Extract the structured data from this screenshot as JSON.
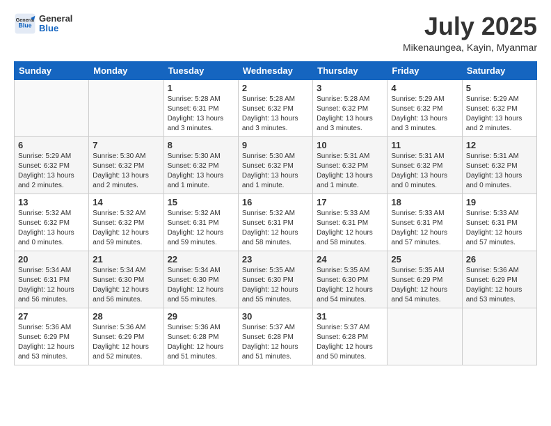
{
  "logo": {
    "general": "General",
    "blue": "Blue"
  },
  "title": "July 2025",
  "subtitle": "Mikenaungea, Kayin, Myanmar",
  "header_days": [
    "Sunday",
    "Monday",
    "Tuesday",
    "Wednesday",
    "Thursday",
    "Friday",
    "Saturday"
  ],
  "weeks": [
    [
      {
        "day": "",
        "info": ""
      },
      {
        "day": "",
        "info": ""
      },
      {
        "day": "1",
        "info": "Sunrise: 5:28 AM\nSunset: 6:31 PM\nDaylight: 13 hours\nand 3 minutes."
      },
      {
        "day": "2",
        "info": "Sunrise: 5:28 AM\nSunset: 6:32 PM\nDaylight: 13 hours\nand 3 minutes."
      },
      {
        "day": "3",
        "info": "Sunrise: 5:28 AM\nSunset: 6:32 PM\nDaylight: 13 hours\nand 3 minutes."
      },
      {
        "day": "4",
        "info": "Sunrise: 5:29 AM\nSunset: 6:32 PM\nDaylight: 13 hours\nand 3 minutes."
      },
      {
        "day": "5",
        "info": "Sunrise: 5:29 AM\nSunset: 6:32 PM\nDaylight: 13 hours\nand 2 minutes."
      }
    ],
    [
      {
        "day": "6",
        "info": "Sunrise: 5:29 AM\nSunset: 6:32 PM\nDaylight: 13 hours\nand 2 minutes."
      },
      {
        "day": "7",
        "info": "Sunrise: 5:30 AM\nSunset: 6:32 PM\nDaylight: 13 hours\nand 2 minutes."
      },
      {
        "day": "8",
        "info": "Sunrise: 5:30 AM\nSunset: 6:32 PM\nDaylight: 13 hours\nand 1 minute."
      },
      {
        "day": "9",
        "info": "Sunrise: 5:30 AM\nSunset: 6:32 PM\nDaylight: 13 hours\nand 1 minute."
      },
      {
        "day": "10",
        "info": "Sunrise: 5:31 AM\nSunset: 6:32 PM\nDaylight: 13 hours\nand 1 minute."
      },
      {
        "day": "11",
        "info": "Sunrise: 5:31 AM\nSunset: 6:32 PM\nDaylight: 13 hours\nand 0 minutes."
      },
      {
        "day": "12",
        "info": "Sunrise: 5:31 AM\nSunset: 6:32 PM\nDaylight: 13 hours\nand 0 minutes."
      }
    ],
    [
      {
        "day": "13",
        "info": "Sunrise: 5:32 AM\nSunset: 6:32 PM\nDaylight: 13 hours\nand 0 minutes."
      },
      {
        "day": "14",
        "info": "Sunrise: 5:32 AM\nSunset: 6:32 PM\nDaylight: 12 hours\nand 59 minutes."
      },
      {
        "day": "15",
        "info": "Sunrise: 5:32 AM\nSunset: 6:31 PM\nDaylight: 12 hours\nand 59 minutes."
      },
      {
        "day": "16",
        "info": "Sunrise: 5:32 AM\nSunset: 6:31 PM\nDaylight: 12 hours\nand 58 minutes."
      },
      {
        "day": "17",
        "info": "Sunrise: 5:33 AM\nSunset: 6:31 PM\nDaylight: 12 hours\nand 58 minutes."
      },
      {
        "day": "18",
        "info": "Sunrise: 5:33 AM\nSunset: 6:31 PM\nDaylight: 12 hours\nand 57 minutes."
      },
      {
        "day": "19",
        "info": "Sunrise: 5:33 AM\nSunset: 6:31 PM\nDaylight: 12 hours\nand 57 minutes."
      }
    ],
    [
      {
        "day": "20",
        "info": "Sunrise: 5:34 AM\nSunset: 6:31 PM\nDaylight: 12 hours\nand 56 minutes."
      },
      {
        "day": "21",
        "info": "Sunrise: 5:34 AM\nSunset: 6:30 PM\nDaylight: 12 hours\nand 56 minutes."
      },
      {
        "day": "22",
        "info": "Sunrise: 5:34 AM\nSunset: 6:30 PM\nDaylight: 12 hours\nand 55 minutes."
      },
      {
        "day": "23",
        "info": "Sunrise: 5:35 AM\nSunset: 6:30 PM\nDaylight: 12 hours\nand 55 minutes."
      },
      {
        "day": "24",
        "info": "Sunrise: 5:35 AM\nSunset: 6:30 PM\nDaylight: 12 hours\nand 54 minutes."
      },
      {
        "day": "25",
        "info": "Sunrise: 5:35 AM\nSunset: 6:29 PM\nDaylight: 12 hours\nand 54 minutes."
      },
      {
        "day": "26",
        "info": "Sunrise: 5:36 AM\nSunset: 6:29 PM\nDaylight: 12 hours\nand 53 minutes."
      }
    ],
    [
      {
        "day": "27",
        "info": "Sunrise: 5:36 AM\nSunset: 6:29 PM\nDaylight: 12 hours\nand 53 minutes."
      },
      {
        "day": "28",
        "info": "Sunrise: 5:36 AM\nSunset: 6:29 PM\nDaylight: 12 hours\nand 52 minutes."
      },
      {
        "day": "29",
        "info": "Sunrise: 5:36 AM\nSunset: 6:28 PM\nDaylight: 12 hours\nand 51 minutes."
      },
      {
        "day": "30",
        "info": "Sunrise: 5:37 AM\nSunset: 6:28 PM\nDaylight: 12 hours\nand 51 minutes."
      },
      {
        "day": "31",
        "info": "Sunrise: 5:37 AM\nSunset: 6:28 PM\nDaylight: 12 hours\nand 50 minutes."
      },
      {
        "day": "",
        "info": ""
      },
      {
        "day": "",
        "info": ""
      }
    ]
  ]
}
